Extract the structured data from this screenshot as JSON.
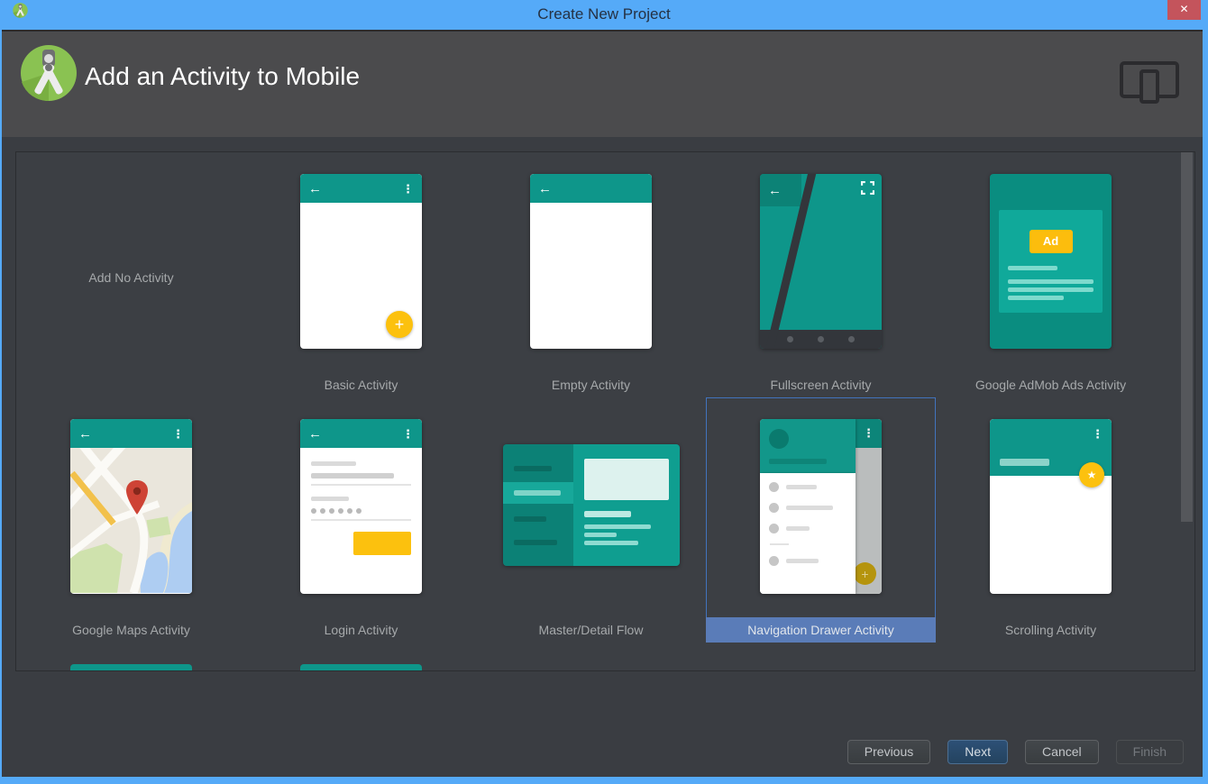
{
  "window": {
    "title": "Create New Project"
  },
  "header": {
    "title": "Add an Activity to Mobile"
  },
  "icons": {
    "close": "✕",
    "back": "←",
    "overflow": "⋮",
    "plus": "+",
    "star": "★"
  },
  "templates": [
    {
      "id": "add-no-activity",
      "label": "Add No Activity",
      "selected": false
    },
    {
      "id": "basic-activity",
      "label": "Basic Activity",
      "selected": false
    },
    {
      "id": "empty-activity",
      "label": "Empty Activity",
      "selected": false
    },
    {
      "id": "fullscreen-activity",
      "label": "Fullscreen Activity",
      "selected": false
    },
    {
      "id": "google-admob-ads-activity",
      "label": "Google AdMob Ads Activity",
      "selected": false,
      "badge": "Ad"
    },
    {
      "id": "google-maps-activity",
      "label": "Google Maps Activity",
      "selected": false
    },
    {
      "id": "login-activity",
      "label": "Login Activity",
      "selected": false
    },
    {
      "id": "master-detail-flow",
      "label": "Master/Detail Flow",
      "selected": false
    },
    {
      "id": "navigation-drawer-activity",
      "label": "Navigation Drawer Activity",
      "selected": true
    },
    {
      "id": "scrolling-activity",
      "label": "Scrolling Activity",
      "selected": false
    }
  ],
  "footer": {
    "buttons": [
      {
        "label": "Previous",
        "enabled": true,
        "primary": false
      },
      {
        "label": "Next",
        "enabled": true,
        "primary": true
      },
      {
        "label": "Cancel",
        "enabled": true,
        "primary": false
      },
      {
        "label": "Finish",
        "enabled": false,
        "primary": false
      }
    ]
  },
  "colors": {
    "titlebar_blue": "#55aaf8",
    "close_red": "#c4545c",
    "header_gray": "#4b4b4d",
    "main_background": "#3a3d42",
    "material_teal": "#0e968a",
    "accent_yellow": "#fcc10e",
    "selection_blue": "#5a7cb8",
    "selection_border": "#4273bd"
  }
}
